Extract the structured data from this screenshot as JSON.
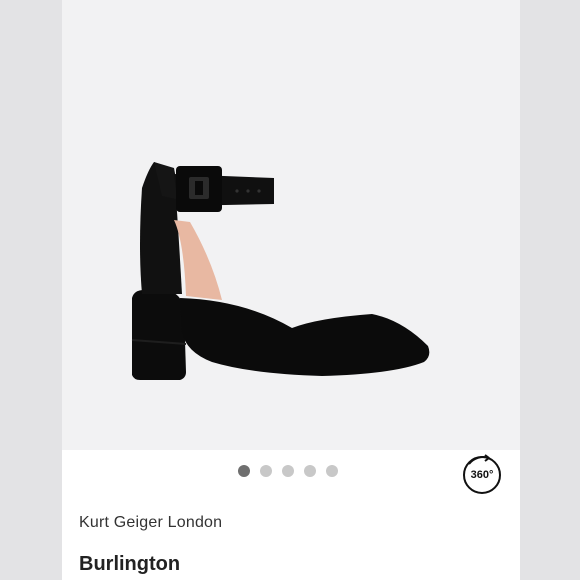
{
  "product": {
    "brand": "Kurt Geiger London",
    "name": "Burlington"
  },
  "gallery": {
    "image_count": 5,
    "active_index": 0,
    "view_360_label": "360°"
  },
  "colors": {
    "background": "#e3e3e5",
    "stage": "#f2f2f3",
    "dot_active": "#6f6f6f",
    "dot_inactive": "#c8c8c8"
  }
}
